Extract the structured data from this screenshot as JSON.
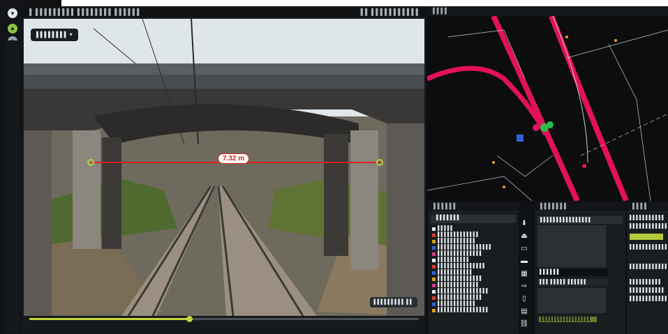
{
  "app": {
    "viewer_title": "▌ ▌▌▌▌▌▌▌▌▌ ▌▌▌▌▌▌▌▌ ▌▌▌▌▌▌",
    "viewer_right": "▌▌ ▌▌▌▌▌▌▌▌▌▌▌",
    "photo_chip": "▌▌▌▌▌▌▌▌ ▾",
    "measurement": "7.32 m",
    "corner_label": "▌▌▌▌▌▌▌▌▌ ▌▌",
    "timeline_progress": 0.41,
    "map_title": "▌▌▌▌",
    "panel1_title": "▌▌▌▌▌▌",
    "panel1_search": "▌▌▌▌▌▌▌",
    "panel2_title": "▌▌▌▌▌▌▌",
    "panel2_input": "▌▌▌▌▌▌▌▌▌▌▌▌▌▌▌▌",
    "panel2_select": "▌▌▌▌▌▌",
    "panel2_row": "▌▌▌ ▌▌▌▌▌   ▌▌▌▌▌▌",
    "panel2_button": "▌▌▌▌▌▌▌▌▌▌▌▌▌▌▌▌▌",
    "panel3_title": "▌▌▌▌",
    "panel3_rows": [
      "▌▌▌▌▌▌▌▌▌▌▌",
      "▌▌▌▌▌▌▌▌▌▌▌▌",
      "▌▌▌▌▌▌▌▌▌▌▌▌▌",
      "▌▌▌▌▌▌▌▌▌▌▌▌▌",
      "▌▌▌▌▌▌▌▌▌▌",
      "▌▌▌▌▌▌▌▌▌▌▌",
      "▌▌▌▌▌▌▌▌▌▌▌▌"
    ],
    "layer_tree": [
      {
        "label": "▌▌▌▌▌",
        "color": "#e8ebed"
      },
      {
        "label": "▌▌▌▌▌▌▌▌▌▌▌▌▌",
        "color": "#e03a2f"
      },
      {
        "label": "▌▌▌▌▌▌▌▌▌▌▌▌",
        "color": "#d4a11c"
      },
      {
        "label": "▌▌▌▌▌▌▌▌▌▌▌▌▌▌▌▌▌",
        "color": "#2f65d6"
      },
      {
        "label": "▌▌▌▌▌▌▌▌▌▌▌▌▌▌",
        "color": "#d93a8c"
      },
      {
        "label": "▌▌▌▌▌▌▌▌▌▌",
        "color": "#e8ebed"
      },
      {
        "label": "▌▌▌▌▌▌▌▌▌▌▌▌▌▌▌",
        "color": "#e03a2f"
      },
      {
        "label": "▌▌▌▌▌▌▌▌▌▌▌",
        "color": "#2f65d6"
      },
      {
        "label": "▌▌▌▌▌▌▌▌▌▌▌▌▌▌",
        "color": "#d4a11c"
      },
      {
        "label": "▌▌▌▌▌▌▌▌▌▌▌▌▌",
        "color": "#d93a8c"
      },
      {
        "label": "▌▌▌▌▌▌▌▌▌▌▌▌▌▌▌▌",
        "color": "#e8ebed"
      },
      {
        "label": "▌▌▌▌▌▌▌▌▌▌▌▌▌▌",
        "color": "#e03a2f"
      },
      {
        "label": "▌▌▌▌▌▌▌▌▌▌▌▌",
        "color": "#2f65d6"
      },
      {
        "label": "▌▌▌▌▌▌▌▌▌▌▌▌▌▌▌▌",
        "color": "#d4a11c"
      }
    ],
    "colors": {
      "accent": "#c7d63a",
      "measure": "#d9241f",
      "map_track": "#e2115a",
      "map_lines": "#c9ced3"
    },
    "icons": {
      "nav1": "logo-icon",
      "nav2": "layers-icon",
      "nav3": "settings-icon"
    }
  }
}
